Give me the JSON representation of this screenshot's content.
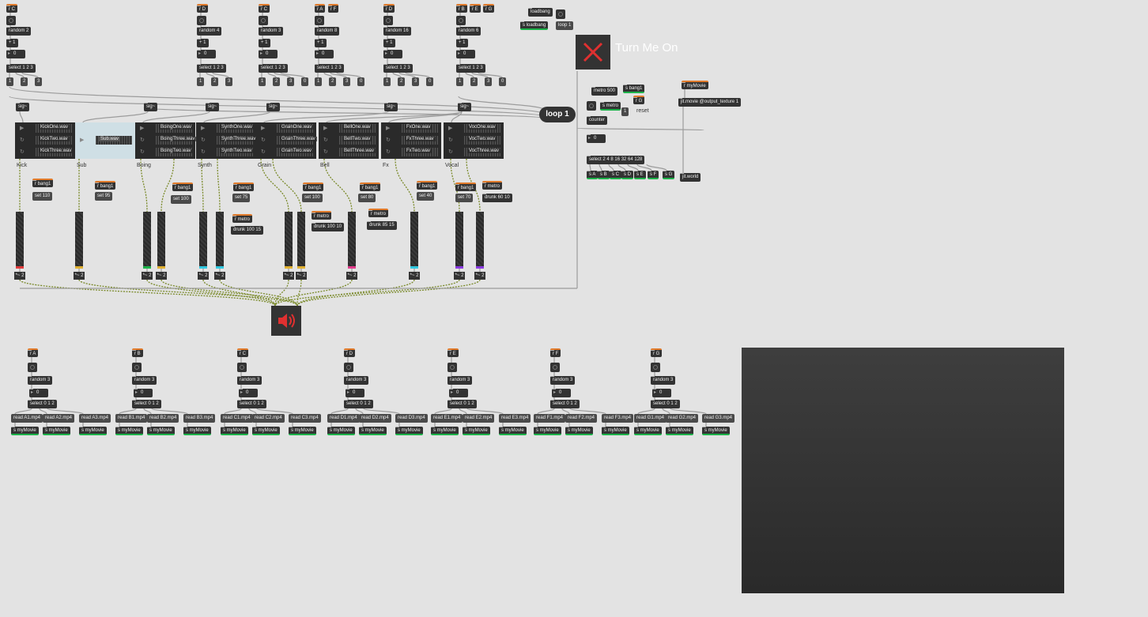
{
  "colors": {
    "background": "#e3e3e3",
    "object": "#333333",
    "send_outlet": "#1db34a",
    "recv_inlet": "#e07a2a",
    "patch_cord": "#9c9c9c",
    "signal_cord": "#7a8a2a",
    "toggle_x": "#e03030",
    "speaker": "#e03030"
  },
  "top_controls": {
    "loadbang": "loadbang",
    "s_loadbang": "s loadbang",
    "loop_msg": "loop 1",
    "turn_on_label": "Turn Me On",
    "loop_button": "loop 1",
    "metro": "metro 500",
    "s_bang1": "s bang1",
    "s_metro": "s metro",
    "r_g": "r G",
    "reset_num": "1",
    "reset_label": "reset",
    "counter": "counter",
    "counter_num": "0",
    "select_counter": "select 2 4 8 16 32 64 128",
    "sends": [
      "s A",
      "s B",
      "s C",
      "s D",
      "s E",
      "s F",
      "s G"
    ],
    "r_mymovie": "r myMovie",
    "jit_movie": "jit.movie @output_texture 1",
    "jit_world": "jit.world"
  },
  "seq_columns": [
    {
      "recv": [
        "r C"
      ],
      "random": "random 2",
      "plus": "+ 1",
      "num": "0",
      "select": "select 1 2 3",
      "msgs": [
        "1",
        "2",
        "3"
      ]
    },
    {
      "recv": [
        "r D"
      ],
      "random": "random 4",
      "plus": "+ 1",
      "num": "0",
      "select": "select 1 2 3",
      "msgs": [
        "1",
        "2",
        "3"
      ]
    },
    {
      "recv": [
        "r C"
      ],
      "random": "random 3",
      "plus": "+ 1",
      "num": "0",
      "select": "select 1 2 3",
      "msgs": [
        "1",
        "2",
        "3",
        "0"
      ]
    },
    {
      "recv": [
        "r A",
        "r F"
      ],
      "random": "random 8",
      "plus": "+ 1",
      "num": "0",
      "select": "select 1 2 3",
      "msgs": [
        "1",
        "2",
        "3",
        "0"
      ]
    },
    {
      "recv": [
        "r D"
      ],
      "random": "random 16",
      "plus": "+ 1",
      "num": "0",
      "select": "select 1 2 3",
      "msgs": [
        "1",
        "2",
        "3",
        "0"
      ]
    },
    {
      "recv": [
        "r B",
        "r E",
        "r G"
      ],
      "random": "random 6",
      "plus": "+ 1",
      "num": "0",
      "select": "select 1 2 3",
      "msgs": [
        "1",
        "2",
        "3",
        "0"
      ]
    }
  ],
  "sig_labels": [
    "sig~",
    "sig~",
    "sig~",
    "sig~",
    "sig~",
    "sig~"
  ],
  "players": [
    {
      "label": "Kick",
      "files": [
        "KickOne.wav",
        "KickTwo.wav",
        "KickThree.wav"
      ]
    },
    {
      "label": "Sub",
      "files": [
        "Sub.wav"
      ]
    },
    {
      "label": "Boing",
      "files": [
        "BoingOne.wav",
        "BoingThree.wav",
        "BoingTwo.wav"
      ]
    },
    {
      "label": "Synth",
      "files": [
        "SynthOne.wav",
        "SynthThree.wav",
        "SynthTwo.wav"
      ]
    },
    {
      "label": "Grain",
      "files": [
        "GrainOne.wav",
        "GrainThree.wav",
        "GrainTwo.wav"
      ]
    },
    {
      "label": "Bell",
      "files": [
        "BellOne.wav",
        "BellTwo.wav",
        "BellThree.wav"
      ]
    },
    {
      "label": "Fx",
      "files": [
        "FxOne.wav",
        "FxThree.wav",
        "FxTwo.wav"
      ]
    },
    {
      "label": "Vocal",
      "files": [
        "VocOne.wav",
        "VocTwo.wav",
        "VocThree.wav"
      ]
    }
  ],
  "gain": {
    "r_bang1": "r bang1",
    "r_metro": "r metro",
    "sets": [
      "set 110",
      "set 95",
      "set 100",
      "set 75",
      "set 100",
      "set 80",
      "set 40",
      "set 70"
    ],
    "drunks": [
      "drunk 100 15",
      "drunk 100 10",
      "drunk 85 15",
      "drunk 60 10"
    ],
    "mult": "*~ 2"
  },
  "video_columns": [
    {
      "recv": "r A",
      "random": "random 3",
      "num": "0",
      "select": "select 0 1 2",
      "reads": [
        "read A1.mp4",
        "read A2.mp4",
        "read A3.mp4"
      ],
      "send": "s myMovie"
    },
    {
      "recv": "r B",
      "random": "random 3",
      "num": "0",
      "select": "select 0 1 2",
      "reads": [
        "read B1.mp4",
        "read B2.mp4",
        "read B3.mp4"
      ],
      "send": "s myMovie"
    },
    {
      "recv": "r C",
      "random": "random 3",
      "num": "0",
      "select": "select 0 1 2",
      "reads": [
        "read C1.mp4",
        "read C2.mp4",
        "read C3.mp4"
      ],
      "send": "s myMovie"
    },
    {
      "recv": "r D",
      "random": "random 3",
      "num": "0",
      "select": "select 0 1 2",
      "reads": [
        "read D1.mp4",
        "read D2.mp4",
        "read D3.mp4"
      ],
      "send": "s myMovie"
    },
    {
      "recv": "r E",
      "random": "random 3",
      "num": "0",
      "select": "select 0 1 2",
      "reads": [
        "read E1.mp4",
        "read E2.mp4",
        "read E3.mp4"
      ],
      "send": "s myMovie"
    },
    {
      "recv": "r F",
      "random": "random 3",
      "num": "0",
      "select": "select 0 1 2",
      "reads": [
        "read F1.mp4",
        "read F2.mp4",
        "read F3.mp4"
      ],
      "send": "s myMovie"
    },
    {
      "recv": "r G",
      "random": "random 3",
      "num": "0",
      "select": "select 0 1 2",
      "reads": [
        "read G1.mp4",
        "read G2.mp4",
        "read G3.mp4"
      ],
      "send": "s myMovie"
    }
  ]
}
